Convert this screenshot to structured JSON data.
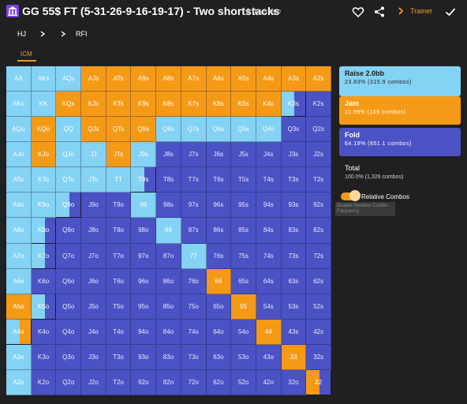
{
  "header": {
    "title": "GG 55$ FT (5-31-26-9-16-19-17) - Two shortstacks",
    "time": "6 days ago",
    "trainer_label": "Trainer"
  },
  "breadcrumb": {
    "position": "HJ",
    "action": "RFI"
  },
  "tab": {
    "label": "ICM"
  },
  "legend": {
    "raise": {
      "title": "Raise 2.0bb",
      "sub": "23.83% (315.9 combos)",
      "color": "#84d2f4"
    },
    "jam": {
      "title": "Jam",
      "sub": "11.99% (159 combos)",
      "color": "#f59a17"
    },
    "fold": {
      "title": "Fold",
      "sub": "64.18% (851.1 combos)",
      "color": "#4b52c4"
    }
  },
  "total": {
    "label": "Total",
    "value": "100.0% (1,326 combos)"
  },
  "toggle": {
    "label": "Relative Combos",
    "tooltip": "Disable Relative Combo Frequency"
  },
  "matrix": {
    "hands": [
      [
        "AA",
        "AKs",
        "AQs",
        "AJs",
        "ATs",
        "A9s",
        "A8s",
        "A7s",
        "A6s",
        "A5s",
        "A4s",
        "A3s",
        "A2s"
      ],
      [
        "AKo",
        "KK",
        "KQs",
        "KJs",
        "KTs",
        "K9s",
        "K8s",
        "K7s",
        "K6s",
        "K5s",
        "K4s",
        "K3s",
        "K2s"
      ],
      [
        "AQo",
        "KQo",
        "QQ",
        "QJs",
        "QTs",
        "Q9s",
        "Q8s",
        "Q7s",
        "Q6s",
        "Q5s",
        "Q4s",
        "Q3s",
        "Q2s"
      ],
      [
        "AJo",
        "KJo",
        "QJo",
        "JJ",
        "JTs",
        "J9s",
        "J8s",
        "J7s",
        "J6s",
        "J5s",
        "J4s",
        "J3s",
        "J2s"
      ],
      [
        "ATo",
        "KTo",
        "QTo",
        "JTo",
        "TT",
        "T9s",
        "T8s",
        "T7s",
        "T6s",
        "T5s",
        "T4s",
        "T3s",
        "T2s"
      ],
      [
        "A9o",
        "K9o",
        "Q9o",
        "J9o",
        "T9o",
        "99",
        "98s",
        "97s",
        "96s",
        "95s",
        "94s",
        "93s",
        "92s"
      ],
      [
        "A8o",
        "K8o",
        "Q8o",
        "J8o",
        "T8o",
        "98o",
        "88",
        "87s",
        "86s",
        "85s",
        "84s",
        "83s",
        "82s"
      ],
      [
        "A7o",
        "K7o",
        "Q7o",
        "J7o",
        "T7o",
        "97o",
        "87o",
        "77",
        "76s",
        "75s",
        "74s",
        "73s",
        "72s"
      ],
      [
        "A6o",
        "K6o",
        "Q6o",
        "J6o",
        "T6o",
        "96o",
        "86o",
        "76o",
        "66",
        "65s",
        "64s",
        "63s",
        "62s"
      ],
      [
        "A5o",
        "K5o",
        "Q5o",
        "J5o",
        "T5o",
        "95o",
        "85o",
        "75o",
        "65o",
        "55",
        "54s",
        "53s",
        "52s"
      ],
      [
        "A4o",
        "K4o",
        "Q4o",
        "J4o",
        "T4o",
        "94o",
        "84o",
        "74o",
        "64o",
        "54o",
        "44",
        "43s",
        "42s"
      ],
      [
        "A3o",
        "K3o",
        "Q3o",
        "J3o",
        "T3o",
        "93o",
        "83o",
        "73o",
        "63o",
        "53o",
        "43o",
        "33",
        "32s"
      ],
      [
        "A2o",
        "K2o",
        "Q2o",
        "J2o",
        "T2o",
        "92o",
        "82o",
        "72o",
        "62o",
        "52o",
        "42o",
        "32o",
        "22"
      ]
    ],
    "strategy": [
      [
        "R",
        "R",
        "R",
        "J",
        "J",
        "J",
        "J",
        "J",
        "J",
        "J",
        "J",
        "J",
        "J"
      ],
      [
        "R",
        "R",
        "J",
        "J",
        "J",
        "J",
        "J",
        "J",
        "J",
        "J",
        "J",
        "RF",
        "F"
      ],
      [
        "R",
        "J",
        "R",
        "J",
        "J",
        "J",
        "R",
        "R",
        "R",
        "R",
        "R",
        "F",
        "F"
      ],
      [
        "R",
        "J",
        "R",
        "R",
        "J",
        "R",
        "F",
        "F",
        "F",
        "F",
        "F",
        "F",
        "F"
      ],
      [
        "R",
        "R",
        "R",
        "R",
        "R",
        "RF",
        "F",
        "F",
        "F",
        "F",
        "F",
        "F",
        "F"
      ],
      [
        "R",
        "R",
        "RF",
        "F",
        "F",
        "R",
        "F",
        "F",
        "F",
        "F",
        "F",
        "F",
        "F"
      ],
      [
        "R",
        "RF",
        "F",
        "F",
        "F",
        "F",
        "R",
        "F",
        "F",
        "F",
        "F",
        "F",
        "F"
      ],
      [
        "R",
        "RF",
        "F",
        "F",
        "F",
        "F",
        "F",
        "R",
        "F",
        "F",
        "F",
        "F",
        "F"
      ],
      [
        "R",
        "F",
        "F",
        "F",
        "F",
        "F",
        "F",
        "F",
        "J",
        "F",
        "F",
        "F",
        "F"
      ],
      [
        "J",
        "RF",
        "F",
        "F",
        "F",
        "F",
        "F",
        "F",
        "F",
        "J",
        "F",
        "F",
        "F"
      ],
      [
        "RJ",
        "F",
        "F",
        "F",
        "F",
        "F",
        "F",
        "F",
        "F",
        "F",
        "J",
        "F",
        "F"
      ],
      [
        "R",
        "F",
        "F",
        "F",
        "F",
        "F",
        "F",
        "F",
        "F",
        "F",
        "F",
        "J",
        "F"
      ],
      [
        "R",
        "F",
        "F",
        "F",
        "F",
        "F",
        "F",
        "F",
        "F",
        "F",
        "F",
        "F",
        "JF"
      ]
    ]
  }
}
